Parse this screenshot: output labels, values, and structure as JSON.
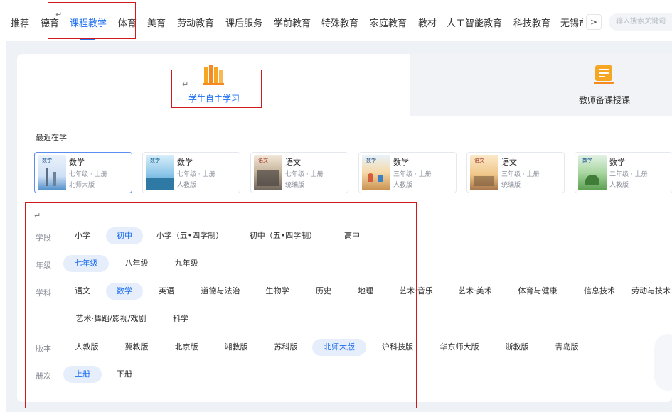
{
  "nav": {
    "items": [
      "推荐",
      "德育",
      "课程教学",
      "体育",
      "美育",
      "劳动教育",
      "课后服务",
      "学前教育",
      "特殊教育",
      "家庭教育",
      "教材",
      "人工智能教育",
      "科技教育",
      "无锡市"
    ],
    "active_index": 2,
    "more_glyph": ">",
    "search_placeholder": "输入搜索关键词"
  },
  "return_glyph": "↵",
  "tabs": {
    "student": "学生自主学习",
    "teacher": "教师备课授课"
  },
  "recent": {
    "title": "最近在学",
    "courses": [
      {
        "subject": "数学",
        "grade": "七年级 · 上册",
        "edition": "北师大版"
      },
      {
        "subject": "数学",
        "grade": "七年级 · 上册",
        "edition": "人教版"
      },
      {
        "subject": "语文",
        "grade": "七年级 · 上册",
        "edition": "统编版"
      },
      {
        "subject": "数学",
        "grade": "三年级 · 上册",
        "edition": "人教版"
      },
      {
        "subject": "语文",
        "grade": "三年级 · 上册",
        "edition": "统编版"
      },
      {
        "subject": "数学",
        "grade": "二年级 · 上册",
        "edition": "人教版"
      }
    ],
    "cover_titles": [
      "数学",
      "数学",
      "语文",
      "数学",
      "语文",
      "数学"
    ]
  },
  "filters": {
    "stage": {
      "label": "学段",
      "options": [
        "小学",
        "初中",
        "小学（五•四学制）",
        "初中（五•四学制）",
        "高中"
      ],
      "selected": 1
    },
    "grade": {
      "label": "年级",
      "options": [
        "七年级",
        "八年级",
        "九年级"
      ],
      "selected": 0
    },
    "subject": {
      "label": "学科",
      "options": [
        "语文",
        "数学",
        "英语",
        "道德与法治",
        "生物学",
        "历史",
        "地理",
        "艺术·音乐",
        "艺术·美术",
        "体育与健康",
        "信息技术",
        "劳动与技术",
        "艺术·舞蹈/影视/戏剧",
        "科学"
      ],
      "selected": 1
    },
    "edition": {
      "label": "版本",
      "options": [
        "人教版",
        "冀教版",
        "北京版",
        "湘教版",
        "苏科版",
        "北师大版",
        "沪科技版",
        "华东师大版",
        "浙教版",
        "青岛版"
      ],
      "selected": 5
    },
    "volume": {
      "label": "册次",
      "options": [
        "上册",
        "下册"
      ],
      "selected": 0
    }
  },
  "colors": {
    "accent": "#1e6ff0",
    "highlight": "#d0191b",
    "icon_orange": "#f5a623"
  }
}
